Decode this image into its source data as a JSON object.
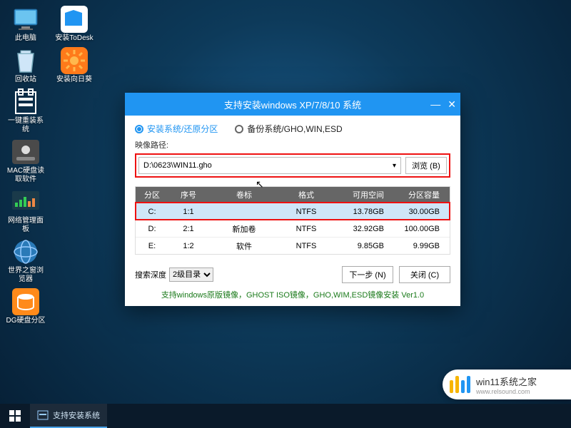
{
  "desktop": {
    "icons": [
      {
        "label": "此电脑",
        "icon": "pc"
      },
      {
        "label": "安装ToDesk",
        "icon": "todesk"
      },
      {
        "label": "回收站",
        "icon": "recycle"
      },
      {
        "label": "安装向日葵",
        "icon": "sunflower"
      },
      {
        "label": "一键重装系统",
        "icon": "reinstall"
      },
      {
        "label": "MAC硬盘读取软件",
        "icon": "macdisk"
      },
      {
        "label": "网络管理面板",
        "icon": "netpanel"
      },
      {
        "label": "世界之窗浏览器",
        "icon": "browser"
      },
      {
        "label": "DG硬盘分区",
        "icon": "dg"
      }
    ]
  },
  "window": {
    "title": "支持安装windows XP/7/8/10 系统",
    "radio_install": "安装系统/还原分区",
    "radio_backup": "备份系统/GHO,WIN,ESD",
    "path_label": "映像路径:",
    "path_value": "D:\\0623\\WIN11.gho",
    "browse_label": "浏览 (B)",
    "columns": {
      "c1": "分区",
      "c2": "序号",
      "c3": "卷标",
      "c4": "格式",
      "c5": "可用空间",
      "c6": "分区容量"
    },
    "rows": [
      {
        "c1": "C:",
        "c2": "1:1",
        "c3": "",
        "c4": "NTFS",
        "c5": "13.78GB",
        "c6": "30.00GB",
        "sel": true
      },
      {
        "c1": "D:",
        "c2": "2:1",
        "c3": "新加卷",
        "c4": "NTFS",
        "c5": "32.92GB",
        "c6": "100.00GB"
      },
      {
        "c1": "E:",
        "c2": "1:2",
        "c3": "软件",
        "c4": "NTFS",
        "c5": "9.85GB",
        "c6": "9.99GB"
      }
    ],
    "depth_label": "搜索深度",
    "depth_value": "2级目录",
    "next_label": "下一步 (N)",
    "close_label": "关闭 (C)",
    "version_text": "支持windows原版镜像，GHOST ISO镜像，GHO,WIM,ESD镜像安装 Ver1.0"
  },
  "taskbar": {
    "item_label": "支持安装系统"
  },
  "watermark": {
    "text": "win11系统之家",
    "url": "www.relsound.com"
  }
}
